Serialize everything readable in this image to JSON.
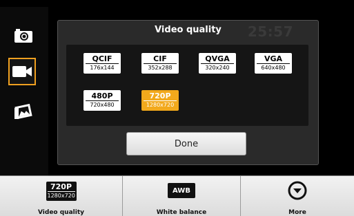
{
  "dialog": {
    "title": "Video quality",
    "timer": "25:57",
    "done_label": "Done",
    "options": [
      {
        "name": "QCIF",
        "res": "176x144",
        "selected": false
      },
      {
        "name": "CIF",
        "res": "352x288",
        "selected": false
      },
      {
        "name": "QVGA",
        "res": "320x240",
        "selected": false
      },
      {
        "name": "VGA",
        "res": "640x480",
        "selected": false
      },
      {
        "name": "480P",
        "res": "720x480",
        "selected": false
      },
      {
        "name": "720P",
        "res": "1280x720",
        "selected": true
      }
    ]
  },
  "modes": [
    {
      "icon": "camera-icon",
      "active": false
    },
    {
      "icon": "video-camera-icon",
      "active": true
    },
    {
      "icon": "gallery-icon",
      "active": false
    }
  ],
  "bottom_bar": {
    "quality_name": "720P",
    "quality_res": "1280x720",
    "quality_label": "Video quality",
    "awb_badge": "AWB",
    "awb_label": "White balance",
    "more_label": "More"
  },
  "colors": {
    "accent": "#f2a91c",
    "panel": "#2a2a2a"
  }
}
